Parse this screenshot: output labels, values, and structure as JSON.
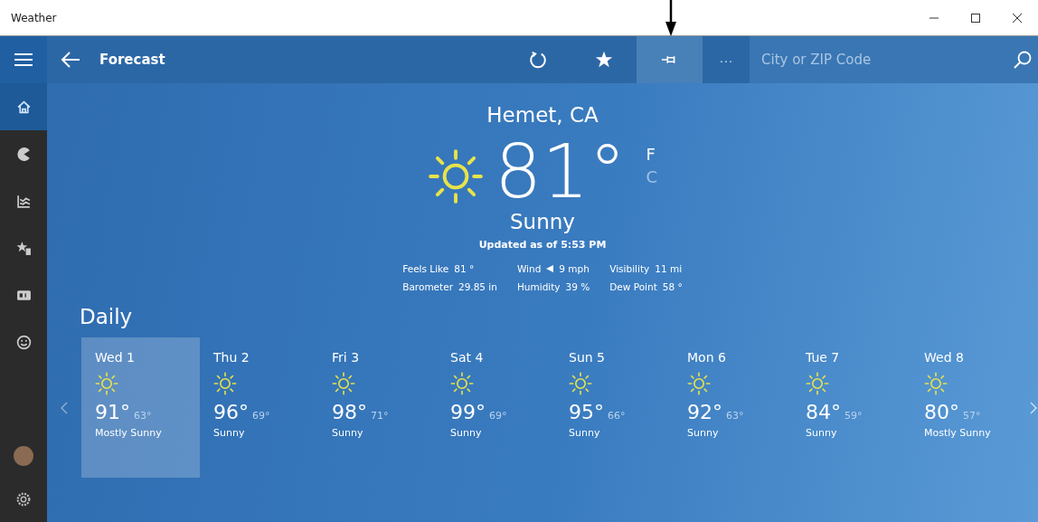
{
  "window": {
    "title": "Weather"
  },
  "toolbar": {
    "title": "Forecast",
    "buttons": [
      {
        "kind": "refresh",
        "selected": false
      },
      {
        "kind": "favorite",
        "selected": false
      },
      {
        "kind": "pin",
        "selected": true
      },
      {
        "kind": "more",
        "label": "···",
        "selected": false
      }
    ],
    "search": {
      "placeholder": "City or ZIP Code"
    }
  },
  "sidebar": {
    "items": [
      {
        "kind": "home",
        "selected": true
      },
      {
        "kind": "crescent",
        "selected": false
      },
      {
        "kind": "chart",
        "selected": false
      },
      {
        "kind": "star-list",
        "selected": false
      },
      {
        "kind": "card",
        "selected": false
      },
      {
        "kind": "smiley",
        "selected": false
      }
    ]
  },
  "current": {
    "location": "Hemet, CA",
    "temperature": "81°",
    "units": [
      {
        "label": "F",
        "selected": true
      },
      {
        "label": "C",
        "selected": false
      }
    ],
    "condition": "Sunny",
    "updated": "Updated as of 5:53 PM",
    "details": [
      {
        "kind": "plain",
        "label": "Feels Like",
        "value": "81 °"
      },
      {
        "kind": "wind",
        "label": "Wind",
        "value": "9 mph"
      },
      {
        "kind": "plain",
        "label": "Visibility",
        "value": "11 mi"
      },
      {
        "kind": "plain",
        "label": "Barometer",
        "value": "29.85 in"
      },
      {
        "kind": "plain",
        "label": "Humidity",
        "value": "39 %"
      },
      {
        "kind": "plain",
        "label": "Dew Point",
        "value": "58 °"
      }
    ]
  },
  "daily": {
    "heading": "Daily",
    "days": [
      {
        "day": "Wed 1",
        "high": "91°",
        "low": "63°",
        "condition": "Mostly Sunny",
        "selected": true
      },
      {
        "day": "Thu 2",
        "high": "96°",
        "low": "69°",
        "condition": "Sunny",
        "selected": false
      },
      {
        "day": "Fri 3",
        "high": "98°",
        "low": "71°",
        "condition": "Sunny",
        "selected": false
      },
      {
        "day": "Sat 4",
        "high": "99°",
        "low": "69°",
        "condition": "Sunny",
        "selected": false
      },
      {
        "day": "Sun 5",
        "high": "95°",
        "low": "66°",
        "condition": "Sunny",
        "selected": false
      },
      {
        "day": "Mon 6",
        "high": "92°",
        "low": "63°",
        "condition": "Sunny",
        "selected": false
      },
      {
        "day": "Tue 7",
        "high": "84°",
        "low": "59°",
        "condition": "Sunny",
        "selected": false
      },
      {
        "day": "Wed 8",
        "high": "80°",
        "low": "57°",
        "condition": "Mostly Sunny",
        "selected": false
      }
    ]
  }
}
